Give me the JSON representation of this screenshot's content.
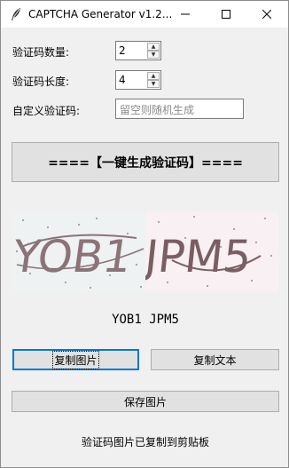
{
  "window": {
    "title": "CAPTCHA Generator v1.2...",
    "icons": [
      "feather-icon",
      "minimize-icon",
      "maximize-icon",
      "close-icon"
    ]
  },
  "form": {
    "count_label": "验证码数量:",
    "count_value": "2",
    "length_label": "验证码长度:",
    "length_value": "4",
    "custom_label": "自定义验证码:",
    "custom_placeholder": "留空则随机生成"
  },
  "generate_button": "====【一键生成验证码】====",
  "captchas": [
    "YOB1",
    "JPM5"
  ],
  "captcha_colors": {
    "first_text": "#8b7378",
    "first_bg": "#eef2f2",
    "second_text": "#7a5e63",
    "second_bg": "#f8f0f3"
  },
  "codes_text": "YOB1 JPM5",
  "buttons": {
    "copy_image": "复制图片",
    "copy_text": "复制文本",
    "save_image": "保存图片"
  },
  "status": "验证码图片已复制到剪贴板"
}
